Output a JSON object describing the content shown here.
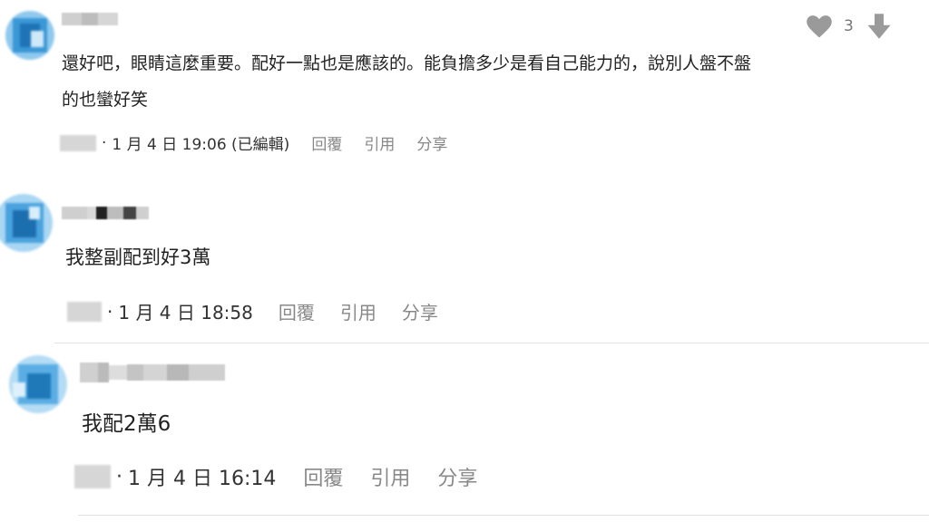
{
  "comments": [
    {
      "body_lines": [
        "還好吧，眼睛這麼重要。配好一點也是應該的。能負擔多少是看自己能力的，說別人盤不盤",
        "的也蠻好笑"
      ],
      "time": "1 月 4 日 19:06 (已編輯)",
      "actions": {
        "reply": "回覆",
        "quote": "引用",
        "share": "分享"
      },
      "like_count": "3",
      "icons": {
        "like": "heart-icon",
        "dislike": "arrow-down-icon"
      }
    },
    {
      "body_lines": [
        "我整副配到好3萬"
      ],
      "time": "1 月 4 日 18:58",
      "actions": {
        "reply": "回覆",
        "quote": "引用",
        "share": "分享"
      }
    },
    {
      "body_lines": [
        "我配2萬6"
      ],
      "time": "1 月 4 日 16:14",
      "actions": {
        "reply": "回覆",
        "quote": "引用",
        "share": "分享"
      }
    }
  ],
  "colors": {
    "avatar": "#2f8fd0",
    "icon_gray": "#999999",
    "action_gray": "#888888",
    "divider": "#e2e2e2"
  }
}
